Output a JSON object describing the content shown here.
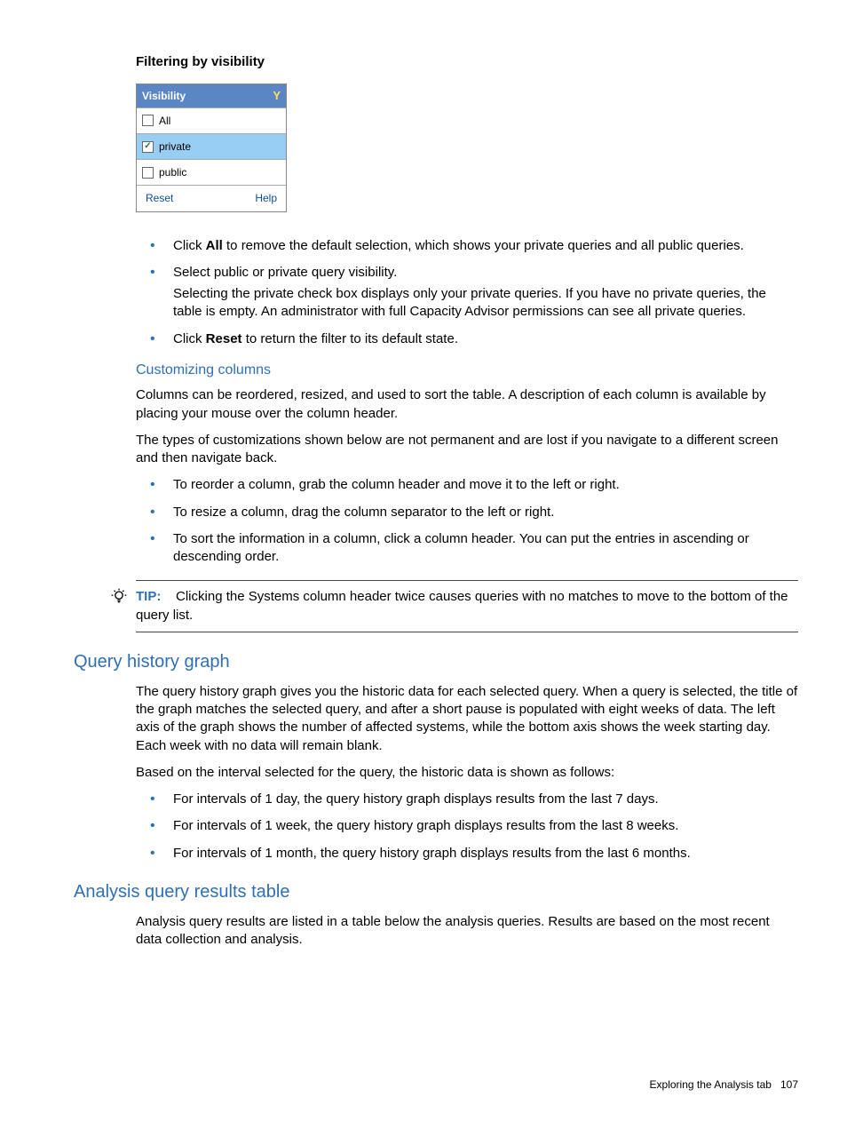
{
  "h1": "Filtering by visibility",
  "filter": {
    "header": "Visibility",
    "opt_all": "All",
    "opt_private": "private",
    "opt_public": "public",
    "reset": "Reset",
    "help": "Help"
  },
  "bullets1": {
    "i0_a": "Click ",
    "i0_b": "All",
    "i0_c": " to remove the default selection, which shows your private queries and all public queries.",
    "i1": "Select public or private query visibility.",
    "i1_sub": "Selecting the private check box displays only your private queries. If you have no private queries, the table is empty. An administrator with full Capacity Advisor permissions can see all private queries.",
    "i2_a": "Click ",
    "i2_b": "Reset",
    "i2_c": " to return the filter to its default state."
  },
  "custom_heading": "Customizing columns",
  "custom_p1": "Columns can be reordered, resized, and used to sort the table. A description of each column is available by placing your mouse over the column header.",
  "custom_p2": "The types of customizations shown below are not permanent and are lost if you navigate to a different screen and then navigate back.",
  "bullets2": {
    "i0": "To reorder a column, grab the column header and move it to the left or right.",
    "i1": "To resize a column, drag the column separator to the left or right.",
    "i2": "To sort the information in a column, click a column header. You can put the entries in ascending or descending order."
  },
  "tip_label": "TIP:",
  "tip_text": "Clicking the Systems column header twice causes queries with no matches to move to the bottom of the query list.",
  "qhg_heading": "Query history graph",
  "qhg_p1": "The query history graph gives you the historic data for each selected query. When a query is selected, the title of the graph matches the selected query, and after a short pause is populated with eight weeks of data. The left axis of the graph shows the number of affected systems, while the bottom axis shows the week starting day. Each week with no data will remain blank.",
  "qhg_p2": "Based on the interval selected for the query, the historic data is shown as follows:",
  "bullets3": {
    "i0": "For intervals of 1 day, the query history graph displays results from the last 7 days.",
    "i1": "For intervals of 1 week, the query history graph displays results from the last 8 weeks.",
    "i2": "For intervals of 1 month, the query history graph displays results from the last 6 months."
  },
  "aqr_heading": "Analysis query results table",
  "aqr_p1": "Analysis query results are listed in a table below the analysis queries. Results are based on the most recent data collection and analysis.",
  "footer_text": "Exploring the Analysis tab",
  "footer_page": "107"
}
